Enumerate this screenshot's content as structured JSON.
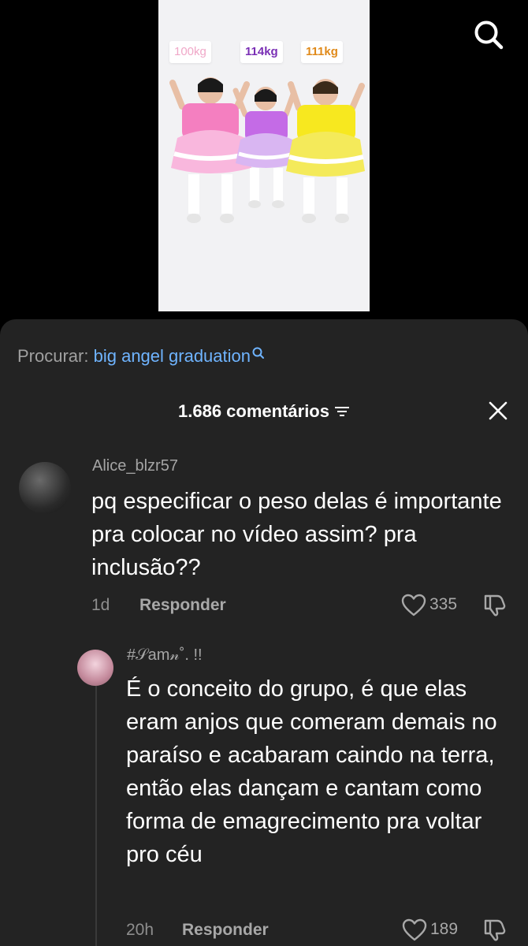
{
  "video": {
    "weights": [
      "100kg",
      "114kg",
      "111kg"
    ]
  },
  "search_bar": {
    "label": "Procurar:",
    "query": "big angel graduation"
  },
  "comments_header": {
    "count_label": "1.686 comentários"
  },
  "comments": [
    {
      "username": "Alice_blzr57",
      "text": "pq especificar o peso delas é importante pra colocar no vídeo assim? pra inclusão??",
      "age": "1d",
      "reply_label": "Responder",
      "likes": "335"
    },
    {
      "username": "#𝒮am𝓃˚. !!",
      "text": "É o conceito do grupo, é que elas eram anjos que comeram demais no paraíso e acabaram caindo na terra, então elas dançam e cantam como forma de emagrecimento pra voltar pro céu",
      "age": "20h",
      "reply_label": "Responder",
      "likes": "189"
    }
  ],
  "icons": {
    "search": "search-icon",
    "sort": "sort-lines-icon",
    "close": "close-icon",
    "like": "heart-outline-icon",
    "dislike": "thumbs-down-icon"
  },
  "colors": {
    "sheet_bg": "#232323",
    "link_blue": "#6fb4ff",
    "muted_text": "#a8a8a8"
  }
}
